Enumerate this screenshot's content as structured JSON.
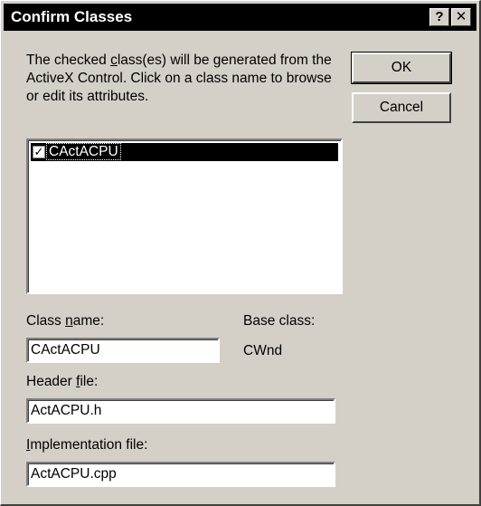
{
  "window": {
    "title": "Confirm Classes",
    "help_glyph": "?",
    "close_glyph": "✕"
  },
  "description": "The checked class(es) will be generated from the ActiveX Control.  Click on a class name to browse or edit its attributes.",
  "buttons": {
    "ok": "OK",
    "cancel": "Cancel"
  },
  "class_list": {
    "items": [
      {
        "label": "CActACPU",
        "checked": true,
        "selected": true
      }
    ]
  },
  "fields": {
    "class_name_label_pre": "Class ",
    "class_name_label_acc": "n",
    "class_name_label_post": "ame:",
    "class_name_value": "CActACPU",
    "base_class_label": "Base class:",
    "base_class_value": "CWnd",
    "header_file_label_pre": "Header ",
    "header_file_label_acc": "f",
    "header_file_label_post": "ile:",
    "header_file_value": "ActACPU.h",
    "implementation_file_label_pre": "",
    "implementation_file_label_acc": "I",
    "implementation_file_label_post": "mplementation file:",
    "implementation_file_value": "ActACPU.cpp"
  },
  "description_acc": {
    "pre": "The checked ",
    "acc": "c",
    "post": "lass(es) will be generated from the ActiveX Control.  Click on a class name to browse or edit its attributes."
  }
}
